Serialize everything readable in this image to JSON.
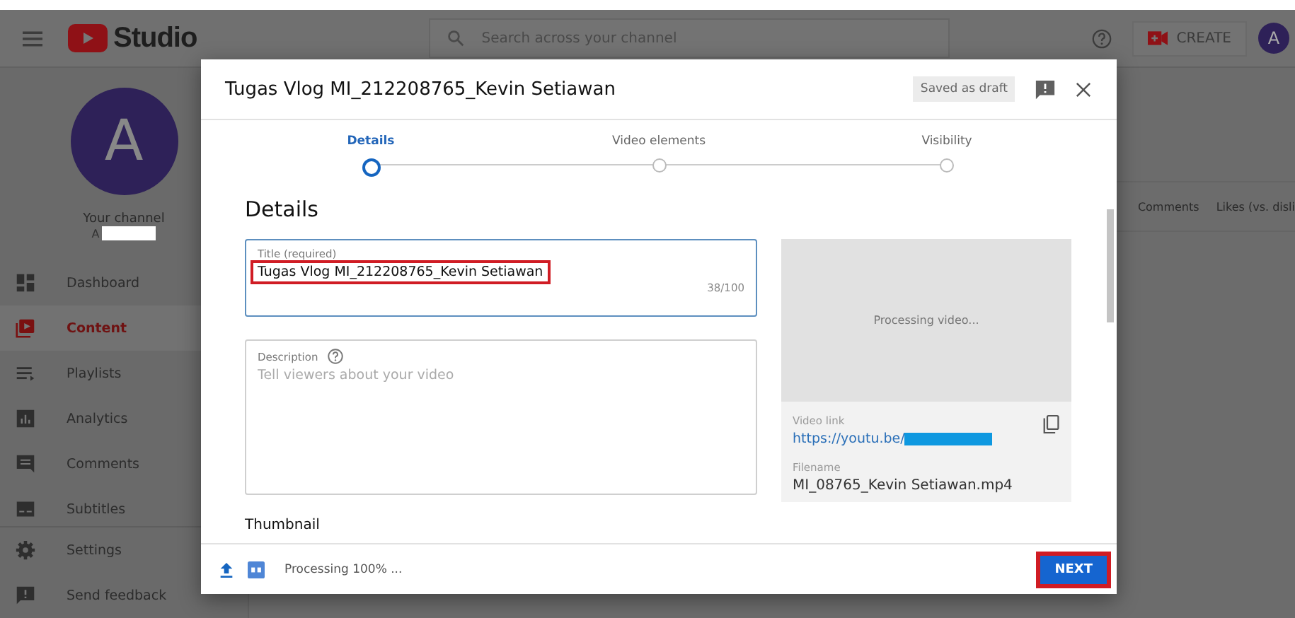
{
  "app": {
    "logo_text": "Studio",
    "search": {
      "placeholder": "Search across your channel"
    },
    "create_button": "CREATE",
    "account_initial": "A"
  },
  "sidebar": {
    "avatar_initial": "A",
    "channel_label": "Your channel",
    "channel_handle": "A",
    "items": [
      {
        "label": "Dashboard",
        "kind": "dashboard",
        "selected": false
      },
      {
        "label": "Content",
        "kind": "content",
        "selected": true
      },
      {
        "label": "Playlists",
        "kind": "playlists",
        "selected": false
      },
      {
        "label": "Analytics",
        "kind": "analytics",
        "selected": false
      },
      {
        "label": "Comments",
        "kind": "comments",
        "selected": false
      },
      {
        "label": "Subtitles",
        "kind": "subtitles",
        "selected": false
      }
    ],
    "footer_items": [
      {
        "label": "Settings",
        "kind": "settings"
      },
      {
        "label": "Send feedback",
        "kind": "feedback"
      }
    ]
  },
  "background_table": {
    "columns": [
      "Comments",
      "Likes (vs. disli"
    ]
  },
  "dialog": {
    "title": "Tugas Vlog MI_212208765_Kevin Setiawan",
    "save_status": "Saved as draft",
    "steps": [
      {
        "label": "Details",
        "selected": true
      },
      {
        "label": "Video elements",
        "selected": false
      },
      {
        "label": "Visibility",
        "selected": false
      }
    ],
    "heading": "Details",
    "title_field": {
      "label": "Title (required)",
      "value": "Tugas Vlog MI_212208765_Kevin Setiawan",
      "counter": "38/100",
      "highlighted": true
    },
    "description_field": {
      "label": "Description",
      "placeholder": "Tell viewers about your video"
    },
    "next_section_heading": "Thumbnail",
    "preview": {
      "status": "Processing video...",
      "link_label": "Video link",
      "link": "https://youtu.be/",
      "filename_label": "Filename",
      "filename": "MI_08765_Kevin Setiawan.mp4"
    },
    "footer": {
      "progress": "Processing 100% ...",
      "next_button": "NEXT",
      "next_highlighted": true
    }
  }
}
